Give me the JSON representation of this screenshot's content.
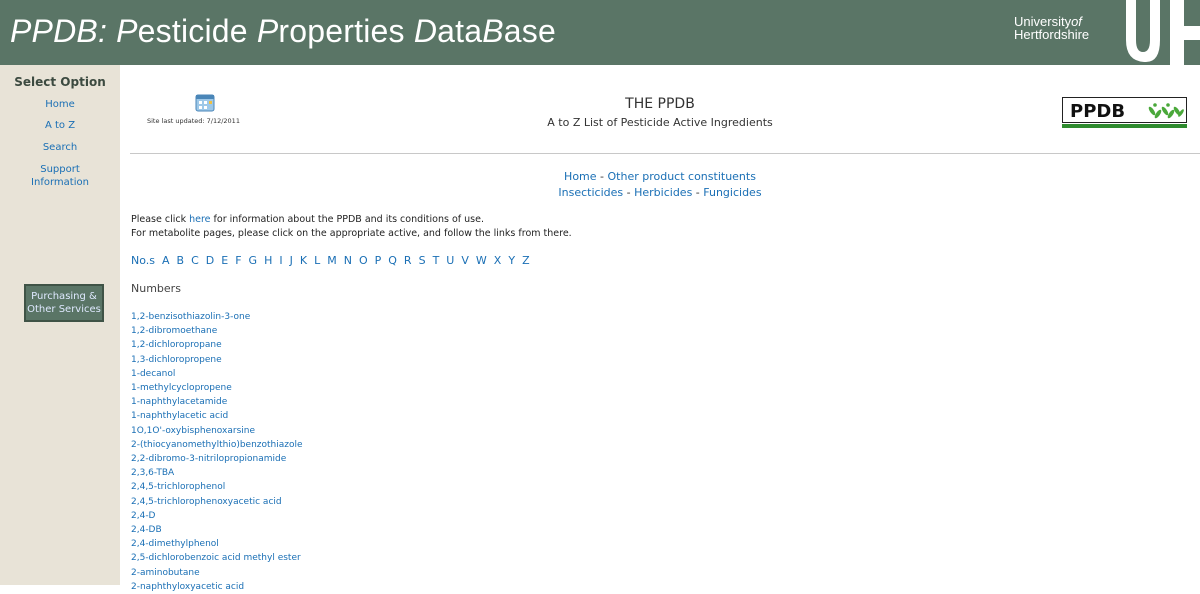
{
  "banner": {
    "title_parts": [
      "PPDB: ",
      "P",
      "esticide ",
      "P",
      "roperties ",
      "D",
      "ata",
      "B",
      "ase"
    ],
    "university_line1": "University",
    "university_of": "of",
    "university_line2": "Hertfordshire"
  },
  "sidebar": {
    "title": "Select Option",
    "links": [
      "Home",
      "A to Z",
      "Search"
    ],
    "support": [
      "Support",
      "Information"
    ],
    "purchasing": [
      "Purchasing &",
      "Other Services"
    ]
  },
  "header": {
    "site_updated": "Site last updated: 7/12/2011",
    "heading": "THE PPDB",
    "subheading": "A to Z List of Pesticide Active Ingredients",
    "logo_text": "PPDB"
  },
  "nav": {
    "home": "Home",
    "other": "Other product constituents",
    "insecticides": "Insecticides",
    "herbicides": "Herbicides",
    "fungicides": "Fungicides",
    "sep": " - "
  },
  "intro": {
    "line1_pre": "Please click ",
    "line1_link": "here",
    "line1_post": " for information about the PPDB and its conditions of use.",
    "line2": "For metabolite pages, please click on the appropriate active, and follow the links from there."
  },
  "alphabet": [
    "No.s",
    "A",
    "B",
    "C",
    "D",
    "E",
    "F",
    "G",
    "H",
    "I",
    "J",
    "K",
    "L",
    "M",
    "N",
    "O",
    "P",
    "Q",
    "R",
    "S",
    "T",
    "U",
    "V",
    "W",
    "X",
    "Y",
    "Z"
  ],
  "numbers_heading": "Numbers",
  "ingredients": [
    "1,2-benzisothiazolin-3-one",
    "1,2-dibromoethane",
    "1,2-dichloropropane",
    "1,3-dichloropropene",
    "1-decanol",
    "1-methylcyclopropene",
    "1-naphthylacetamide",
    "1-naphthylacetic acid",
    "1O,1O'-oxybisphenoxarsine",
    "2-(thiocyanomethylthio)benzothiazole",
    "2,2-dibromo-3-nitrilopropionamide",
    "2,3,6-TBA",
    "2,4,5-trichlorophenol",
    "2,4,5-trichlorophenoxyacetic acid",
    "2,4-D",
    "2,4-DB",
    "2,4-dimethylphenol",
    "2,5-dichlorobenzoic acid methyl ester",
    "2-aminobutane",
    "2-naphthyloxyacetic acid"
  ],
  "colors": {
    "banner": "#5a7566",
    "sidebar": "#e8e3d7",
    "link": "#1a6fb5",
    "logo_green": "#2e8b2e"
  }
}
